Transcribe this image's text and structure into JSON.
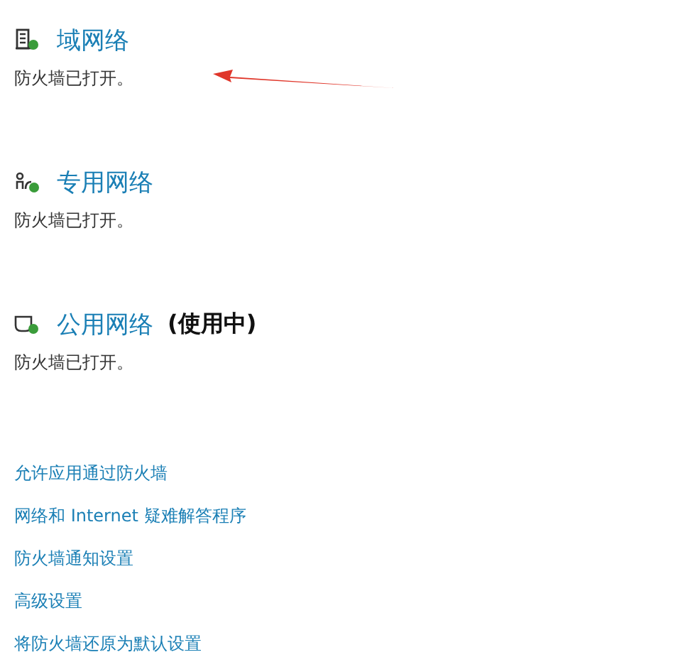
{
  "networks": [
    {
      "kind": "domain",
      "name": "域网络",
      "status": "防火墙已打开。"
    },
    {
      "kind": "private",
      "name": "专用网络",
      "status": "防火墙已打开。"
    },
    {
      "kind": "public",
      "name": "公用网络",
      "in_use": "(使用中)",
      "status": "防火墙已打开。"
    }
  ],
  "links": [
    "允许应用通过防火墙",
    "网络和 Internet 疑难解答程序",
    "防火墙通知设置",
    "高级设置",
    "将防火墙还原为默认设置"
  ]
}
